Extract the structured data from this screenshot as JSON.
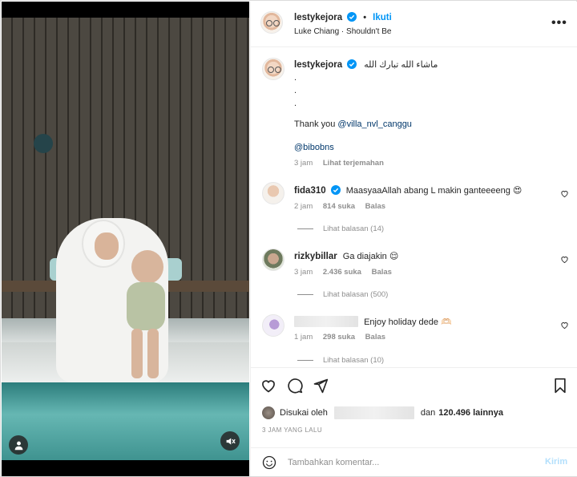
{
  "post": {
    "author": "lestykejora",
    "follow_label": "Ikuti",
    "separator": "•",
    "music": "Luke Chiang · Shouldn't Be",
    "more_label": "•••"
  },
  "caption": {
    "username": "lestykejora",
    "arabic_text": "ماشاء الله تبارك الله",
    "dot_lines": [
      ".",
      ".",
      "."
    ],
    "thanks_prefix": "Thank you ",
    "thanks_mention": "@villa_nvl_canggu",
    "mention2": "@bibobns",
    "time": "3 jam",
    "translate_label": "Lihat terjemahan"
  },
  "comments": [
    {
      "username": "fida310",
      "verified": true,
      "text": "MaasyaaAllah abang L makin ganteeeeng 😍",
      "time": "2 jam",
      "likes": "814 suka",
      "reply_label": "Balas",
      "view_replies": "Lihat balasan (14)"
    },
    {
      "username": "rizkybillar",
      "verified": false,
      "text": "Ga diajakin 😌",
      "time": "3 jam",
      "likes": "2.436 suka",
      "reply_label": "Balas",
      "view_replies": "Lihat balasan (500)"
    },
    {
      "username": "",
      "verified": false,
      "text": "Enjoy holiday dede 🫶🏻",
      "time": "1 jam",
      "likes": "298 suka",
      "reply_label": "Balas",
      "view_replies": "Lihat balasan (10)"
    }
  ],
  "likes": {
    "prefix": "Disukai oleh",
    "middle": "dan",
    "count": "120.496 lainnya"
  },
  "timestamp": "3 JAM YANG LALU",
  "composer": {
    "placeholder": "Tambahkan komentar...",
    "post_label": "Kirim"
  },
  "colors": {
    "accent": "#0095f6",
    "link": "#00376b",
    "muted": "#8e8e8e",
    "post_disabled": "#b2dffc"
  },
  "icons": {
    "media": [
      "user-tag-icon",
      "mute-icon"
    ],
    "actions": [
      "heart-icon",
      "comment-icon",
      "share-icon",
      "bookmark-icon"
    ],
    "composer": [
      "emoji-icon"
    ]
  }
}
